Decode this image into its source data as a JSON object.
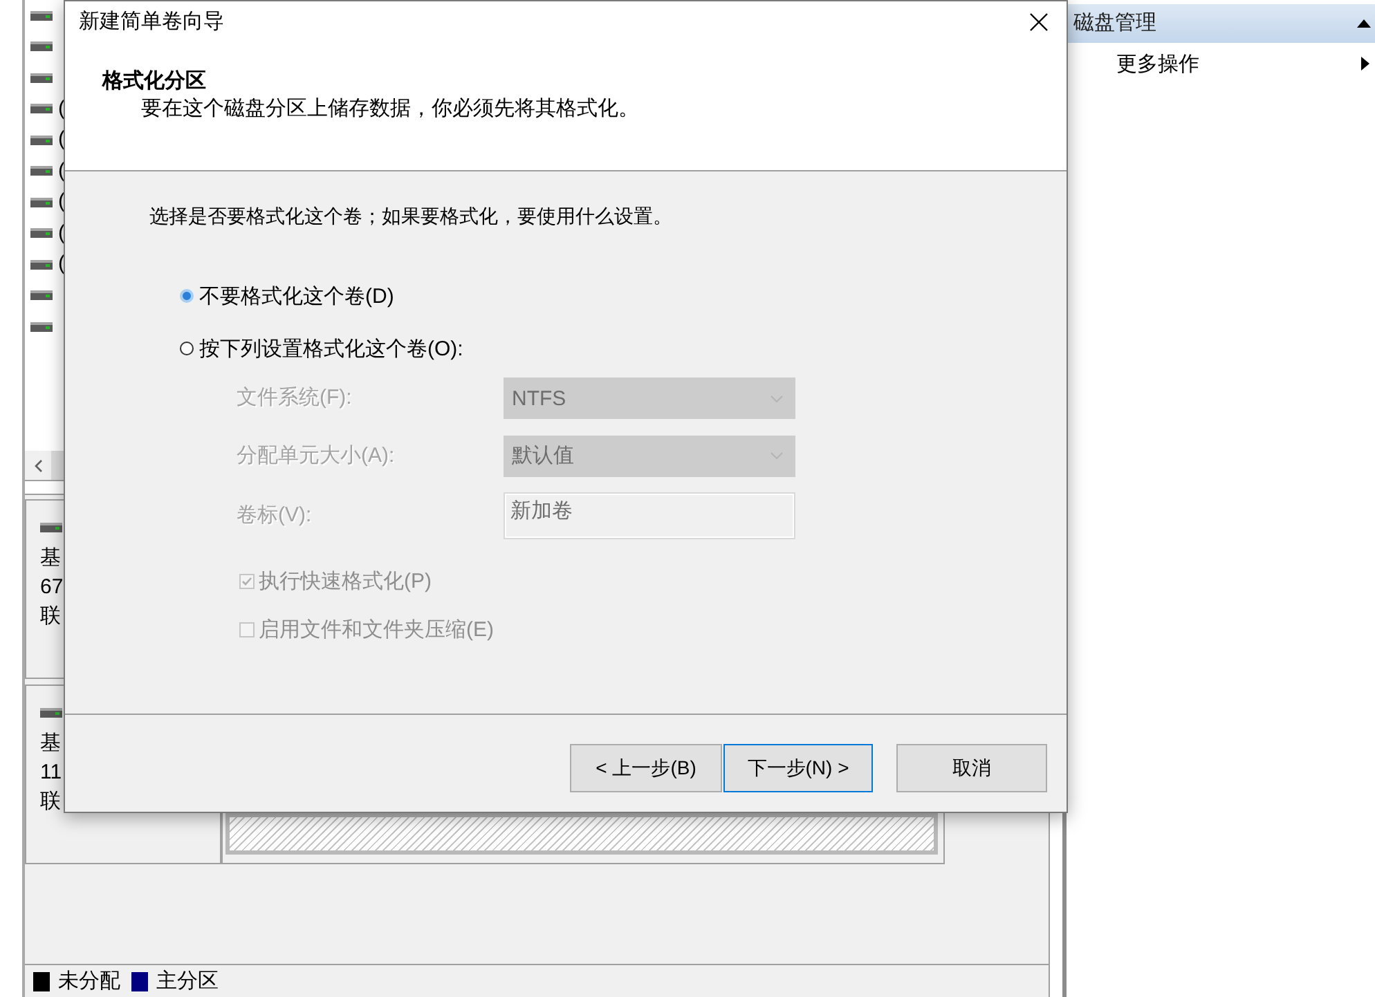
{
  "background_window": {
    "volume_list": [
      {
        "kind": "icon_only"
      },
      {
        "kind": "icon_only"
      },
      {
        "kind": "icon_only"
      },
      {
        "kind": "labeled",
        "label": "("
      },
      {
        "kind": "labeled",
        "label": "("
      },
      {
        "kind": "labeled",
        "label": "("
      },
      {
        "kind": "labeled",
        "label": "("
      },
      {
        "kind": "labeled",
        "label": "("
      },
      {
        "kind": "labeled",
        "label": "("
      },
      {
        "kind": "icon_only"
      },
      {
        "kind": "icon_only"
      }
    ],
    "disks": [
      {
        "info": [
          "基",
          "67",
          "联"
        ]
      },
      {
        "info": [
          "基",
          "11",
          "联"
        ],
        "partitions": [
          {
            "kind": "unallocated"
          }
        ]
      }
    ],
    "legend": [
      {
        "label": "未分配",
        "color": "#000000"
      },
      {
        "label": "主分区",
        "color": "#000080"
      }
    ]
  },
  "action_pane": {
    "title": "磁盘管理",
    "items": [
      {
        "label": "更多操作"
      }
    ]
  },
  "dialog": {
    "title": "新建简单卷向导",
    "heading": "格式化分区",
    "subheading": "要在这个磁盘分区上储存数据，你必须先将其格式化。",
    "instruction": "选择是否要格式化这个卷；如果要格式化，要使用什么设置。",
    "options": [
      {
        "label": "不要格式化这个卷(D)",
        "selected": true
      },
      {
        "label": "按下列设置格式化这个卷(O):",
        "selected": false
      }
    ],
    "settings": [
      {
        "kind": "dropdown",
        "label": "文件系统(F):",
        "value": "NTFS",
        "disabled": true
      },
      {
        "kind": "dropdown",
        "label": "分配单元大小(A):",
        "value": "默认值",
        "disabled": true
      },
      {
        "kind": "text",
        "label": "卷标(V):",
        "value": "新加卷",
        "disabled": true
      }
    ],
    "checkboxes": [
      {
        "label": "执行快速格式化(P)",
        "checked": true,
        "disabled": true
      },
      {
        "label": "启用文件和文件夹压缩(E)",
        "checked": false,
        "disabled": true
      }
    ],
    "buttons": [
      {
        "label": "< 上一步(B)",
        "focused": false
      },
      {
        "label": "下一步(N) >",
        "focused": true
      },
      {
        "label": "取消",
        "focused": false
      }
    ]
  }
}
